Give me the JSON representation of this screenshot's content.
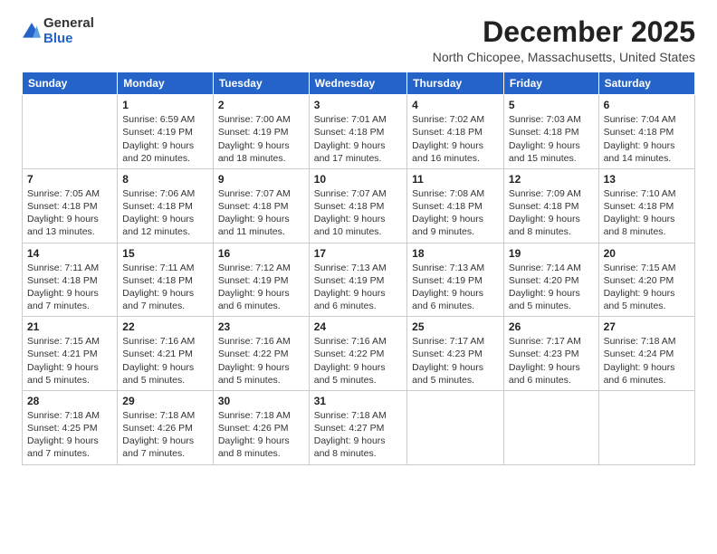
{
  "logo": {
    "general": "General",
    "blue": "Blue"
  },
  "title": "December 2025",
  "location": "North Chicopee, Massachusetts, United States",
  "days_of_week": [
    "Sunday",
    "Monday",
    "Tuesday",
    "Wednesday",
    "Thursday",
    "Friday",
    "Saturday"
  ],
  "weeks": [
    [
      {
        "day": "",
        "text": ""
      },
      {
        "day": "1",
        "text": "Sunrise: 6:59 AM\nSunset: 4:19 PM\nDaylight: 9 hours\nand 20 minutes."
      },
      {
        "day": "2",
        "text": "Sunrise: 7:00 AM\nSunset: 4:19 PM\nDaylight: 9 hours\nand 18 minutes."
      },
      {
        "day": "3",
        "text": "Sunrise: 7:01 AM\nSunset: 4:18 PM\nDaylight: 9 hours\nand 17 minutes."
      },
      {
        "day": "4",
        "text": "Sunrise: 7:02 AM\nSunset: 4:18 PM\nDaylight: 9 hours\nand 16 minutes."
      },
      {
        "day": "5",
        "text": "Sunrise: 7:03 AM\nSunset: 4:18 PM\nDaylight: 9 hours\nand 15 minutes."
      },
      {
        "day": "6",
        "text": "Sunrise: 7:04 AM\nSunset: 4:18 PM\nDaylight: 9 hours\nand 14 minutes."
      }
    ],
    [
      {
        "day": "7",
        "text": "Sunrise: 7:05 AM\nSunset: 4:18 PM\nDaylight: 9 hours\nand 13 minutes."
      },
      {
        "day": "8",
        "text": "Sunrise: 7:06 AM\nSunset: 4:18 PM\nDaylight: 9 hours\nand 12 minutes."
      },
      {
        "day": "9",
        "text": "Sunrise: 7:07 AM\nSunset: 4:18 PM\nDaylight: 9 hours\nand 11 minutes."
      },
      {
        "day": "10",
        "text": "Sunrise: 7:07 AM\nSunset: 4:18 PM\nDaylight: 9 hours\nand 10 minutes."
      },
      {
        "day": "11",
        "text": "Sunrise: 7:08 AM\nSunset: 4:18 PM\nDaylight: 9 hours\nand 9 minutes."
      },
      {
        "day": "12",
        "text": "Sunrise: 7:09 AM\nSunset: 4:18 PM\nDaylight: 9 hours\nand 8 minutes."
      },
      {
        "day": "13",
        "text": "Sunrise: 7:10 AM\nSunset: 4:18 PM\nDaylight: 9 hours\nand 8 minutes."
      }
    ],
    [
      {
        "day": "14",
        "text": "Sunrise: 7:11 AM\nSunset: 4:18 PM\nDaylight: 9 hours\nand 7 minutes."
      },
      {
        "day": "15",
        "text": "Sunrise: 7:11 AM\nSunset: 4:18 PM\nDaylight: 9 hours\nand 7 minutes."
      },
      {
        "day": "16",
        "text": "Sunrise: 7:12 AM\nSunset: 4:19 PM\nDaylight: 9 hours\nand 6 minutes."
      },
      {
        "day": "17",
        "text": "Sunrise: 7:13 AM\nSunset: 4:19 PM\nDaylight: 9 hours\nand 6 minutes."
      },
      {
        "day": "18",
        "text": "Sunrise: 7:13 AM\nSunset: 4:19 PM\nDaylight: 9 hours\nand 6 minutes."
      },
      {
        "day": "19",
        "text": "Sunrise: 7:14 AM\nSunset: 4:20 PM\nDaylight: 9 hours\nand 5 minutes."
      },
      {
        "day": "20",
        "text": "Sunrise: 7:15 AM\nSunset: 4:20 PM\nDaylight: 9 hours\nand 5 minutes."
      }
    ],
    [
      {
        "day": "21",
        "text": "Sunrise: 7:15 AM\nSunset: 4:21 PM\nDaylight: 9 hours\nand 5 minutes."
      },
      {
        "day": "22",
        "text": "Sunrise: 7:16 AM\nSunset: 4:21 PM\nDaylight: 9 hours\nand 5 minutes."
      },
      {
        "day": "23",
        "text": "Sunrise: 7:16 AM\nSunset: 4:22 PM\nDaylight: 9 hours\nand 5 minutes."
      },
      {
        "day": "24",
        "text": "Sunrise: 7:16 AM\nSunset: 4:22 PM\nDaylight: 9 hours\nand 5 minutes."
      },
      {
        "day": "25",
        "text": "Sunrise: 7:17 AM\nSunset: 4:23 PM\nDaylight: 9 hours\nand 5 minutes."
      },
      {
        "day": "26",
        "text": "Sunrise: 7:17 AM\nSunset: 4:23 PM\nDaylight: 9 hours\nand 6 minutes."
      },
      {
        "day": "27",
        "text": "Sunrise: 7:18 AM\nSunset: 4:24 PM\nDaylight: 9 hours\nand 6 minutes."
      }
    ],
    [
      {
        "day": "28",
        "text": "Sunrise: 7:18 AM\nSunset: 4:25 PM\nDaylight: 9 hours\nand 7 minutes."
      },
      {
        "day": "29",
        "text": "Sunrise: 7:18 AM\nSunset: 4:26 PM\nDaylight: 9 hours\nand 7 minutes."
      },
      {
        "day": "30",
        "text": "Sunrise: 7:18 AM\nSunset: 4:26 PM\nDaylight: 9 hours\nand 8 minutes."
      },
      {
        "day": "31",
        "text": "Sunrise: 7:18 AM\nSunset: 4:27 PM\nDaylight: 9 hours\nand 8 minutes."
      },
      {
        "day": "",
        "text": ""
      },
      {
        "day": "",
        "text": ""
      },
      {
        "day": "",
        "text": ""
      }
    ]
  ]
}
